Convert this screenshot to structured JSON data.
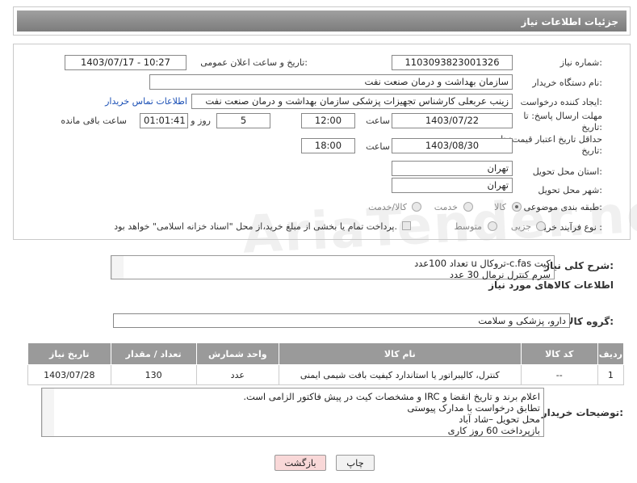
{
  "header": {
    "title": "جزئیات اطلاعات نیاز"
  },
  "form": {
    "need_number_label": "شماره نیاز:",
    "need_number": "1103093823001326",
    "announce_label": "تاریخ و ساعت اعلان عمومی:",
    "announce_value": "1403/07/17 - 10:27",
    "buyer_org_label": "نام دستگاه خریدار:",
    "buyer_org": "سازمان بهداشت و درمان صنعت نفت",
    "creator_label": "ایجاد کننده درخواست:",
    "creator": "زینب عربعلی کارشناس تجهیزات پزشکی سازمان بهداشت و درمان صنعت نفت",
    "contact_link": "اطلاعات تماس خریدار",
    "deadline_label": "مهلت ارسال پاسخ: تا تاریخ:",
    "deadline_date": "1403/07/22",
    "time_word": "ساعت",
    "deadline_time": "12:00",
    "days": "5",
    "days_and": "روز و",
    "remaining": "01:01:41",
    "remaining_label": "ساعت باقی مانده",
    "validity_label": "حداقل تاریخ اعتبار قیمت: تا تاریخ:",
    "validity_date": "1403/08/30",
    "validity_time": "18:00",
    "province_label": "استان محل تحویل:",
    "province": "تهران",
    "city_label": "شهر محل تحویل:",
    "city": "تهران",
    "category_label": "طبقه بندی موضوعی:",
    "cat_goods": "کالا",
    "cat_service": "خدمت",
    "cat_goods_service": "کالا/خدمت",
    "process_label": "نوع فرآیند خرید :",
    "proc_minor": "جزیی",
    "proc_medium": "متوسط",
    "process_note": "پرداخت تمام یا بخشی از مبلغ خرید،از محل \"اسناد خزانه اسلامی\" خواهد بود."
  },
  "summary": {
    "label": "شرح کلی نیاز:",
    "line1": "کیت c.fas-تروکال u تعداد 100عدد",
    "line2": "سرم کنترل نرمال 30 عدد"
  },
  "goods_section": {
    "title": "اطلاعات کالاهای مورد نیاز",
    "group_label": "گروه کالا:",
    "group_value": "دارو، پزشکی و سلامت"
  },
  "table": {
    "headers": {
      "row": "ردیف",
      "code": "کد کالا",
      "name": "نام کالا",
      "unit": "واحد شمارش",
      "qty": "تعداد / مقدار",
      "date": "تاریخ نیاز"
    },
    "rows": [
      {
        "row": "1",
        "code": "--",
        "name": "کنترل، کالیبراتور یا استاندارد کیفیت بافت شیمی ایمنی",
        "unit": "عدد",
        "qty": "130",
        "date": "1403/07/28"
      }
    ]
  },
  "buyer_notes": {
    "label": "توضیحات خریدار:",
    "line1": "اعلام برند و تاریخ انقضا و IRC و مشخصات کیت در پیش فاکتور الزامی است.",
    "line2": "تطابق درخواست با مدارک پیوستی",
    "line3": "محل تحویل –شاد آباد",
    "line4": "بازپرداخت 60 روز کاری"
  },
  "buttons": {
    "print": "چاپ",
    "back": "بازگشت"
  },
  "watermark": "AriaTender.neT",
  "colors": {
    "header_bar": "#8c8c8c",
    "link": "#1a4fb5",
    "back_button_bg": "#f9d8d8"
  }
}
